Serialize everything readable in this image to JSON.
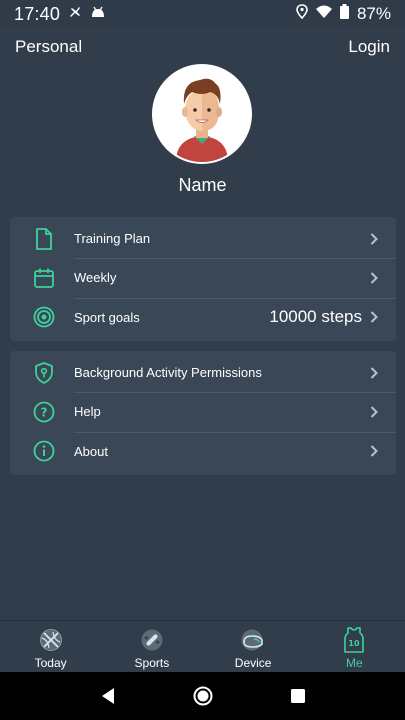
{
  "status_bar": {
    "time": "17:40",
    "battery": "87%"
  },
  "top_bar": {
    "title": "Personal",
    "login_label": "Login"
  },
  "profile": {
    "name": "Name"
  },
  "menu_group_1": [
    {
      "label": "Training Plan",
      "value": "",
      "icon": "document-icon"
    },
    {
      "label": "Weekly",
      "value": "",
      "icon": "calendar-icon"
    },
    {
      "label": "Sport goals",
      "value": "10000 steps",
      "icon": "target-icon"
    }
  ],
  "menu_group_2": [
    {
      "label": "Background Activity Permissions",
      "value": "",
      "icon": "shield-icon"
    },
    {
      "label": "Help",
      "value": "",
      "icon": "help-icon"
    },
    {
      "label": "About",
      "value": "",
      "icon": "info-icon"
    }
  ],
  "bottom_nav": [
    {
      "label": "Today",
      "icon": "basketball-icon",
      "active": false
    },
    {
      "label": "Sports",
      "icon": "sports-icon",
      "active": false
    },
    {
      "label": "Device",
      "icon": "device-icon",
      "active": false
    },
    {
      "label": "Me",
      "icon": "jersey-icon",
      "active": true,
      "jersey_number": "10"
    }
  ],
  "colors": {
    "background": "#313d4b",
    "card": "#3a4756",
    "accent": "#3fd19a"
  }
}
